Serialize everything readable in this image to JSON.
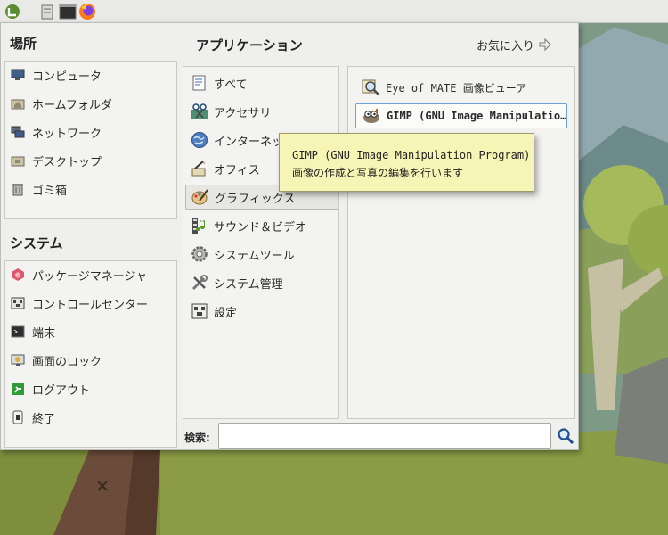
{
  "places": {
    "title": "場所",
    "items": [
      {
        "label": "コンピュータ",
        "icon": "computer-icon"
      },
      {
        "label": "ホームフォルダ",
        "icon": "home-folder-icon"
      },
      {
        "label": "ネットワーク",
        "icon": "network-icon"
      },
      {
        "label": "デスクトップ",
        "icon": "desktop-folder-icon"
      },
      {
        "label": "ゴミ箱",
        "icon": "trash-icon"
      }
    ]
  },
  "system": {
    "title": "システム",
    "items": [
      {
        "label": "パッケージマネージャ",
        "icon": "package-manager-icon"
      },
      {
        "label": "コントロールセンター",
        "icon": "control-center-icon"
      },
      {
        "label": "端末",
        "icon": "terminal-icon"
      },
      {
        "label": "画面のロック",
        "icon": "lock-screen-icon"
      },
      {
        "label": "ログアウト",
        "icon": "logout-icon"
      },
      {
        "label": "終了",
        "icon": "shutdown-icon"
      }
    ]
  },
  "applications": {
    "title": "アプリケーション",
    "favorites_label": "お気に入り",
    "categories": [
      {
        "label": "すべて",
        "icon": "all-apps-icon"
      },
      {
        "label": "アクセサリ",
        "icon": "accessories-icon"
      },
      {
        "label": "インターネット",
        "icon": "internet-icon"
      },
      {
        "label": "オフィス",
        "icon": "office-icon"
      },
      {
        "label": "グラフィックス",
        "icon": "graphics-icon",
        "selected": true
      },
      {
        "label": "サウンド＆ビデオ",
        "icon": "sound-video-icon"
      },
      {
        "label": "システムツール",
        "icon": "system-tools-icon"
      },
      {
        "label": "システム管理",
        "icon": "system-admin-icon"
      },
      {
        "label": "設定",
        "icon": "settings-icon"
      }
    ],
    "apps": [
      {
        "label": "Eye of MATE 画像ビューア",
        "icon": "image-viewer-icon"
      },
      {
        "label": "GIMP (GNU Image Manipulatio…",
        "icon": "gimp-icon",
        "focused": true
      }
    ]
  },
  "tooltip": {
    "line1": "GIMP (GNU Image Manipulation Program)",
    "line2": "画像の作成と写真の編集を行います"
  },
  "search": {
    "label": "検索:",
    "value": "",
    "placeholder": ""
  },
  "colors": {
    "menu_bg": "#efefed",
    "tooltip_bg": "#f7f5b5",
    "focus_border": "#6fa0d8",
    "mint_accent": "#8fbc5a"
  }
}
